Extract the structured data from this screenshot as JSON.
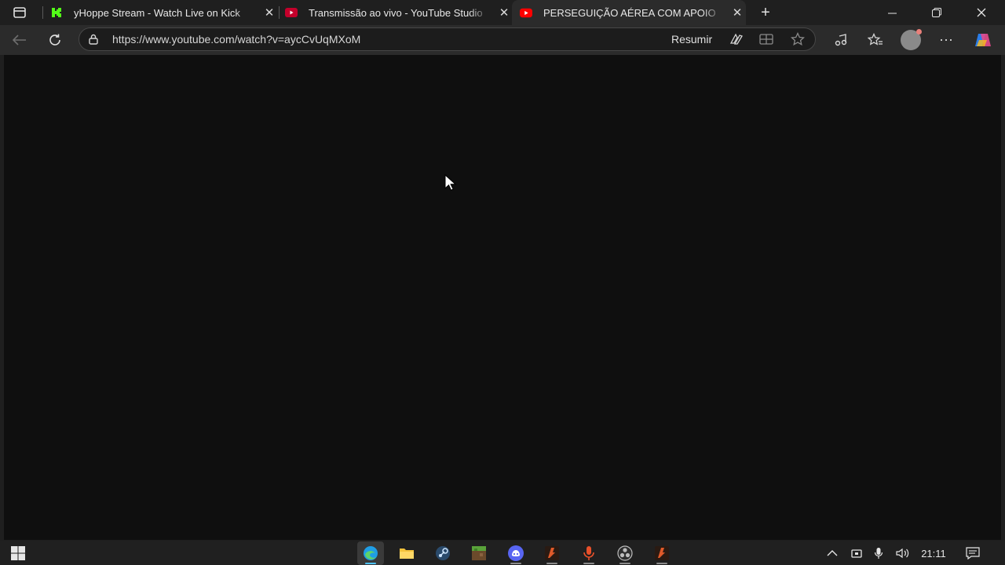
{
  "browser": {
    "tabs": [
      {
        "title": "yHoppe Stream - Watch Live on Kick",
        "favicon": "kick-logo-icon",
        "color": "#53fc18"
      },
      {
        "title": "Transmissão ao vivo - YouTube Studio",
        "favicon": "youtube-studio-icon",
        "color": "#cc0000"
      },
      {
        "title": "PERSEGUIÇÃO AÉREA COM APOIO",
        "favicon": "youtube-icon",
        "color": "#ff0000",
        "active": true
      }
    ],
    "url": "https://www.youtube.com/watch?v=aycCvUqMXoM",
    "summarize_label": "Resumir"
  },
  "taskbar": {
    "pinned": [
      "edge-icon",
      "file-explorer-icon",
      "steam-icon",
      "minecraft-icon",
      "discord-icon",
      "app-icon",
      "microphone-app-icon",
      "obs-icon",
      "app-icon"
    ],
    "clock": "21:11"
  },
  "colors": {
    "page_bg": "#0f0f0f",
    "chrome_bg": "#1f1f1f",
    "toolbar_bg": "#2b2b2b",
    "accent": "#0078d4"
  }
}
